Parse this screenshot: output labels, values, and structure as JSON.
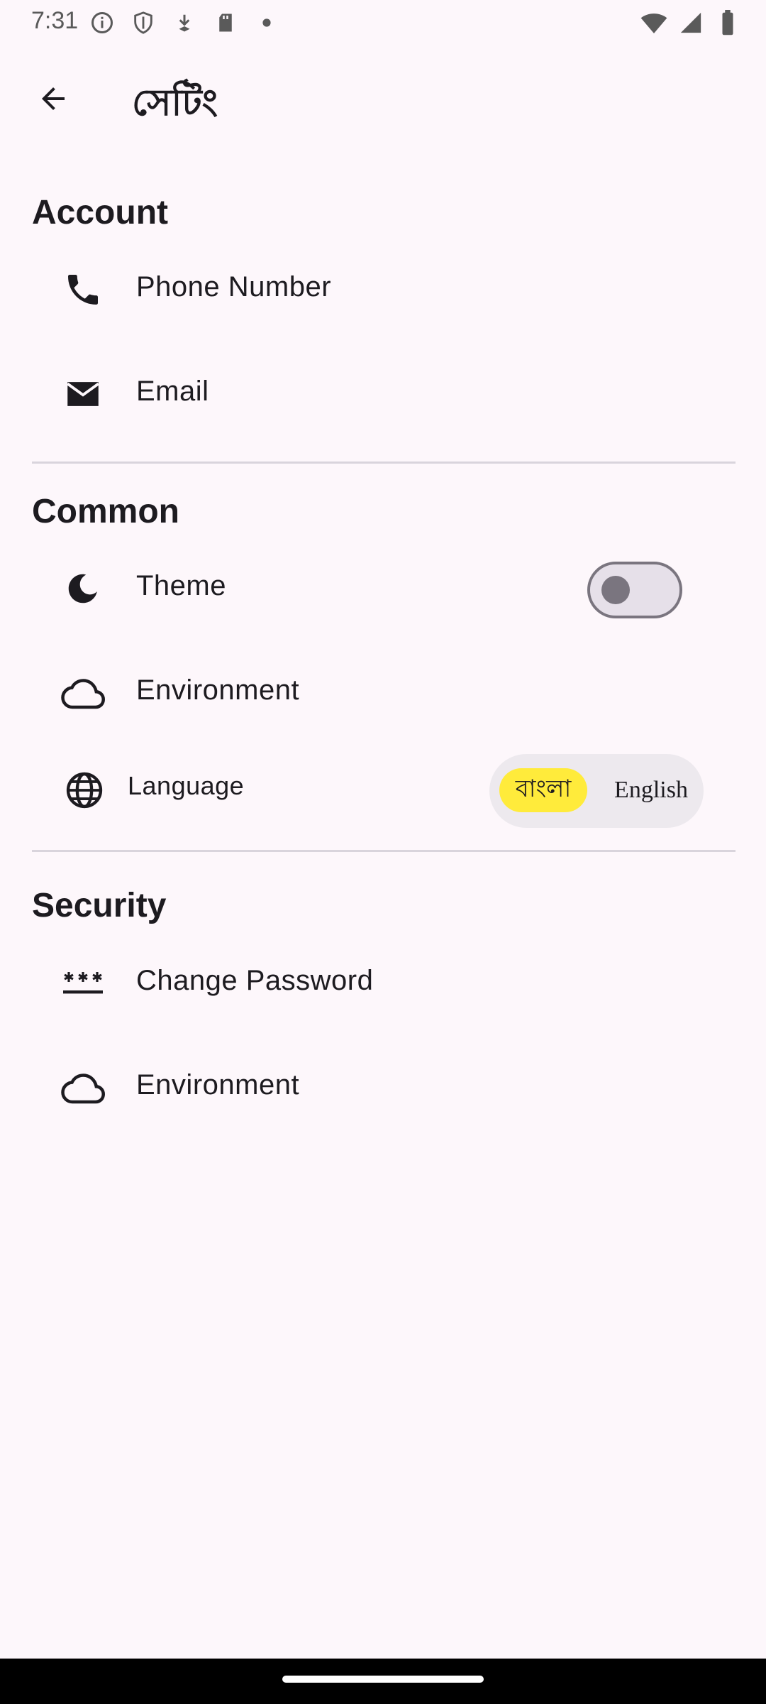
{
  "status_bar": {
    "time": "7:31",
    "left_icons": [
      "info-icon",
      "shield-icon",
      "download-icon",
      "sd-card-icon",
      "dot-icon"
    ],
    "right_icons": [
      "wifi-icon",
      "signal-icon",
      "battery-icon"
    ]
  },
  "app_bar": {
    "title": "সেটিং",
    "back_icon": "arrow-back-icon"
  },
  "sections": {
    "account": {
      "title": "Account",
      "items": [
        {
          "label": "Phone Number",
          "icon": "phone-icon"
        },
        {
          "label": "Email",
          "icon": "mail-icon"
        }
      ]
    },
    "common": {
      "title": "Common",
      "theme": {
        "label": "Theme",
        "icon": "moon-icon",
        "enabled": false
      },
      "environment": {
        "label": "Environment",
        "icon": "cloud-icon"
      },
      "language": {
        "label": "Language",
        "icon": "globe-icon",
        "options": [
          "বাংলা",
          "English"
        ],
        "selected": "বাংলা"
      }
    },
    "security": {
      "title": "Security",
      "items": [
        {
          "label": "Change Password",
          "icon": "password-icon"
        },
        {
          "label": "Environment",
          "icon": "cloud-icon"
        }
      ]
    }
  },
  "colors": {
    "background": "#fdf7fb",
    "selected_language": "#ffeb3b",
    "toggle_track": "#e6e0e9",
    "divider": "#d9d4dc"
  }
}
